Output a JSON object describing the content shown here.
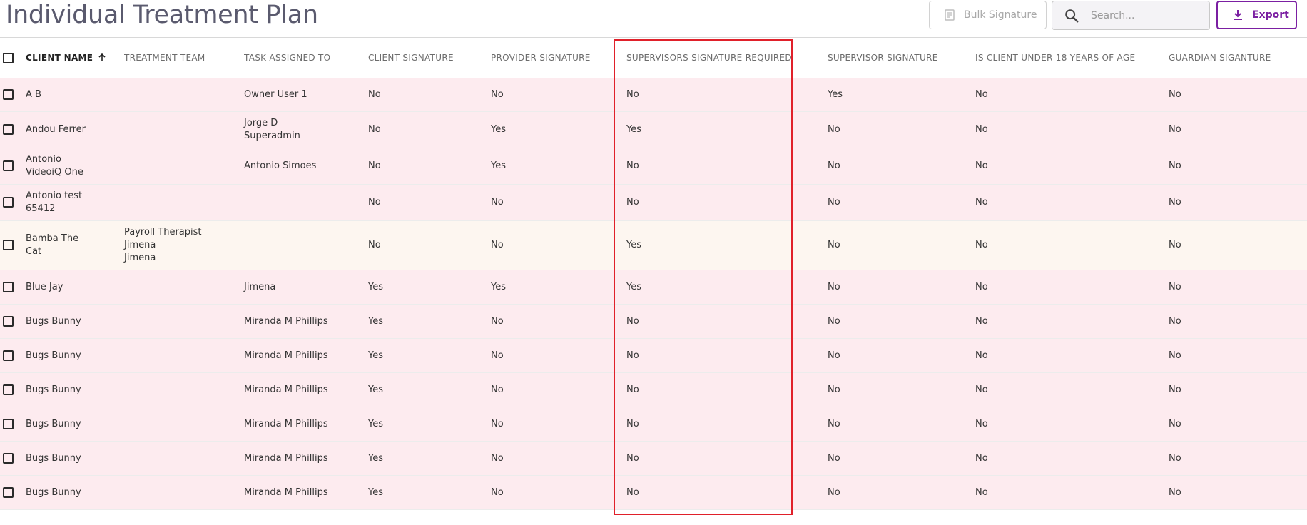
{
  "header": {
    "title": "Individual Treatment Plan",
    "bulk_signature_label": "Bulk Signature",
    "search_placeholder": "Search...",
    "export_label": "Export"
  },
  "table": {
    "columns": [
      "CLIENT NAME",
      "TREATMENT TEAM",
      "TASK ASSIGNED TO",
      "CLIENT SIGNATURE",
      "PROVIDER SIGNATURE",
      "SUPERVISORS SIGNATURE REQUIRED",
      "SUPERVISOR SIGNATURE",
      "IS CLIENT UNDER 18 YEARS OF AGE",
      "GUARDIAN SIGANTURE"
    ],
    "rows": [
      {
        "client": [
          "A B"
        ],
        "team": [],
        "task": [
          "Owner User 1"
        ],
        "client_sig": "No",
        "provider_sig": "No",
        "sup_req": "No",
        "sup_sig": "Yes",
        "under18": "No",
        "guardian": "No"
      },
      {
        "client": [
          "Andou Ferrer"
        ],
        "team": [],
        "task": [
          "Jorge D",
          "Superadmin"
        ],
        "client_sig": "No",
        "provider_sig": "Yes",
        "sup_req": "Yes",
        "sup_sig": "No",
        "under18": "No",
        "guardian": "No"
      },
      {
        "client": [
          "Antonio",
          "VideoiQ One"
        ],
        "team": [],
        "task": [
          "Antonio Simoes"
        ],
        "client_sig": "No",
        "provider_sig": "Yes",
        "sup_req": "No",
        "sup_sig": "No",
        "under18": "No",
        "guardian": "No"
      },
      {
        "client": [
          "Antonio test",
          "65412"
        ],
        "team": [],
        "task": [],
        "client_sig": "No",
        "provider_sig": "No",
        "sup_req": "No",
        "sup_sig": "No",
        "under18": "No",
        "guardian": "No"
      },
      {
        "client": [
          "Bamba The",
          "Cat"
        ],
        "team": [
          "Payroll Therapist",
          "Jimena",
          "Jimena"
        ],
        "task": [],
        "client_sig": "No",
        "provider_sig": "No",
        "sup_req": "Yes",
        "sup_sig": "No",
        "under18": "No",
        "guardian": "No"
      },
      {
        "client": [
          "Blue Jay"
        ],
        "team": [],
        "task": [
          "Jimena"
        ],
        "client_sig": "Yes",
        "provider_sig": "Yes",
        "sup_req": "Yes",
        "sup_sig": "No",
        "under18": "No",
        "guardian": "No"
      },
      {
        "client": [
          "Bugs Bunny"
        ],
        "team": [],
        "task": [
          "Miranda M Phillips"
        ],
        "client_sig": "Yes",
        "provider_sig": "No",
        "sup_req": "No",
        "sup_sig": "No",
        "under18": "No",
        "guardian": "No"
      },
      {
        "client": [
          "Bugs Bunny"
        ],
        "team": [],
        "task": [
          "Miranda M Phillips"
        ],
        "client_sig": "Yes",
        "provider_sig": "No",
        "sup_req": "No",
        "sup_sig": "No",
        "under18": "No",
        "guardian": "No"
      },
      {
        "client": [
          "Bugs Bunny"
        ],
        "team": [],
        "task": [
          "Miranda M Phillips"
        ],
        "client_sig": "Yes",
        "provider_sig": "No",
        "sup_req": "No",
        "sup_sig": "No",
        "under18": "No",
        "guardian": "No"
      },
      {
        "client": [
          "Bugs Bunny"
        ],
        "team": [],
        "task": [
          "Miranda M Phillips"
        ],
        "client_sig": "Yes",
        "provider_sig": "No",
        "sup_req": "No",
        "sup_sig": "No",
        "under18": "No",
        "guardian": "No"
      },
      {
        "client": [
          "Bugs Bunny"
        ],
        "team": [],
        "task": [
          "Miranda M Phillips"
        ],
        "client_sig": "Yes",
        "provider_sig": "No",
        "sup_req": "No",
        "sup_sig": "No",
        "under18": "No",
        "guardian": "No"
      },
      {
        "client": [
          "Bugs Bunny"
        ],
        "team": [],
        "task": [
          "Miranda M Phillips"
        ],
        "client_sig": "Yes",
        "provider_sig": "No",
        "sup_req": "No",
        "sup_sig": "No",
        "under18": "No",
        "guardian": "No"
      }
    ]
  },
  "colors": {
    "row_background": "#fdebef",
    "highlighted_row_background": "#fdf6f0",
    "accent": "#7b1fa2",
    "highlight_border": "#e0202a"
  }
}
